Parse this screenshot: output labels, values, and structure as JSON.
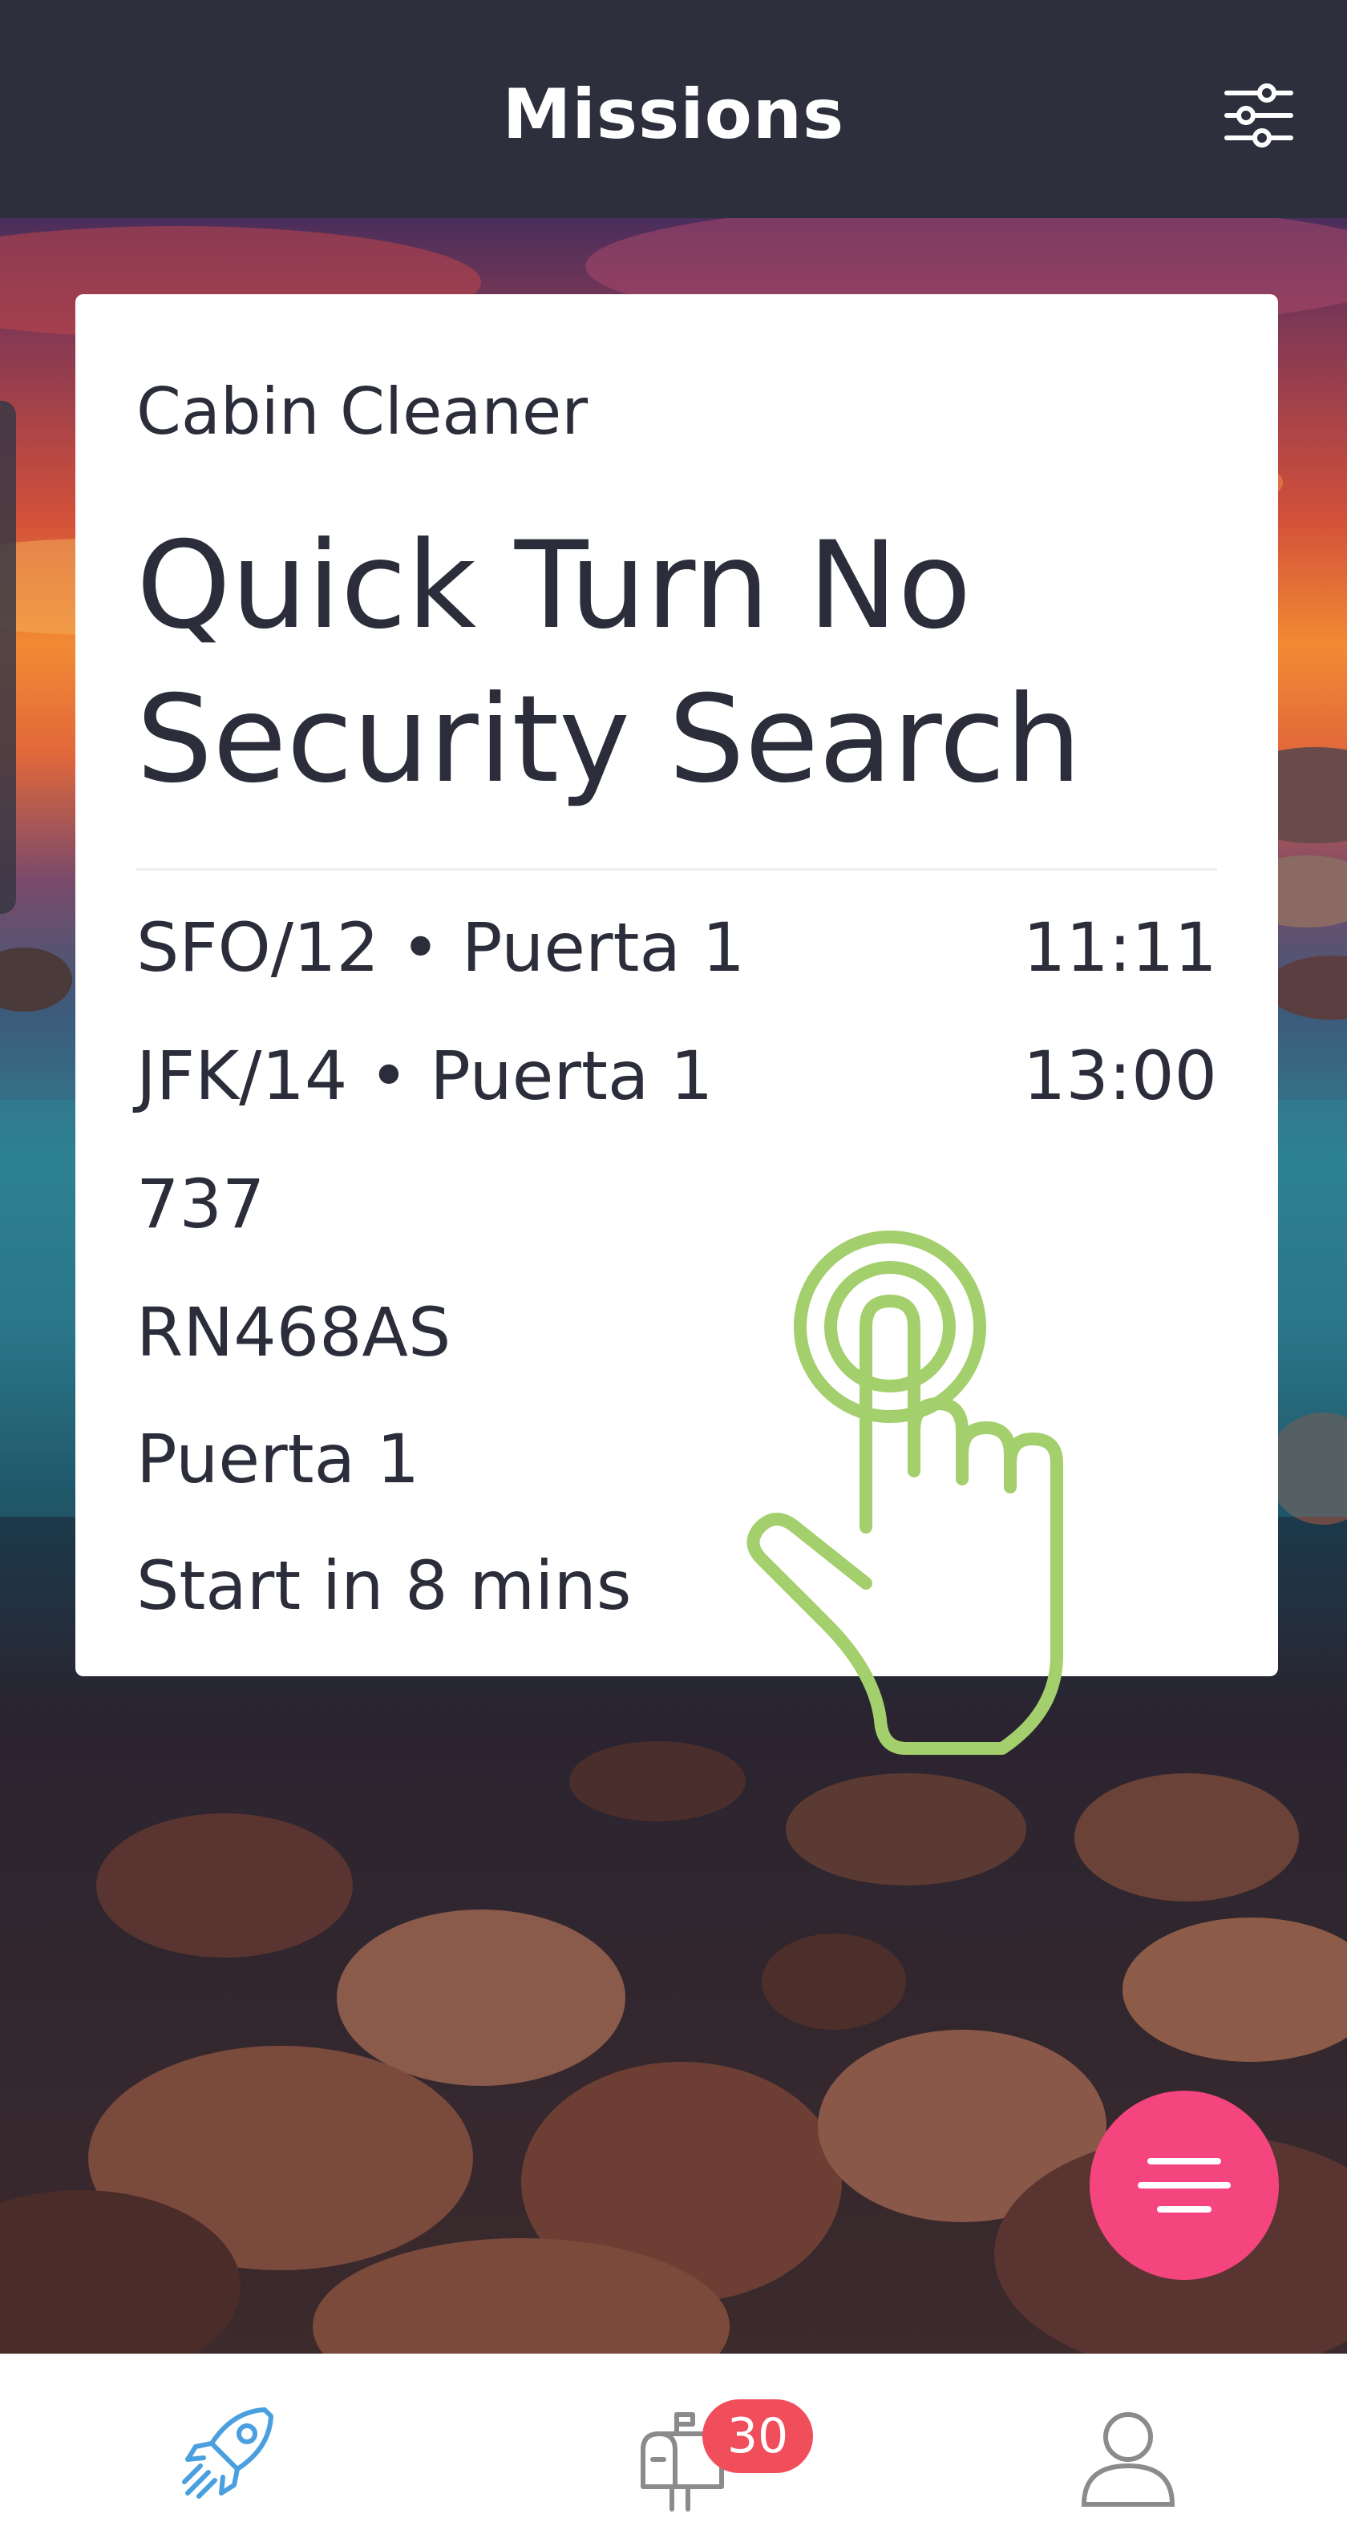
{
  "header": {
    "title": "Missions",
    "filter_icon": "sliders-icon"
  },
  "mission_card": {
    "category": "Cabin Cleaner",
    "title": "Quick Turn No Security Search",
    "origin": {
      "label": "SFO/12 • Puerta 1",
      "time": "11:11"
    },
    "destination": {
      "label": "JFK/14 • Puerta 1",
      "time": "13:00"
    },
    "aircraft_type": "737",
    "registration": "RN468AS",
    "gate": "Puerta 1",
    "start_status": "Start in 8 mins"
  },
  "overlay": {
    "gesture_icon": "tap-hand-icon",
    "gesture_color": "#a3cf6d"
  },
  "fab": {
    "icon": "menu-lines-icon",
    "color": "#f5457f"
  },
  "tabbar": {
    "tabs": [
      {
        "icon": "rocket-icon",
        "active": true
      },
      {
        "icon": "mailbox-icon",
        "active": false,
        "badge": "30"
      },
      {
        "icon": "user-icon",
        "active": false
      }
    ],
    "active_color": "#4a9fe0",
    "inactive_color": "#8b8b8b",
    "badge_color": "#f04e5b"
  }
}
